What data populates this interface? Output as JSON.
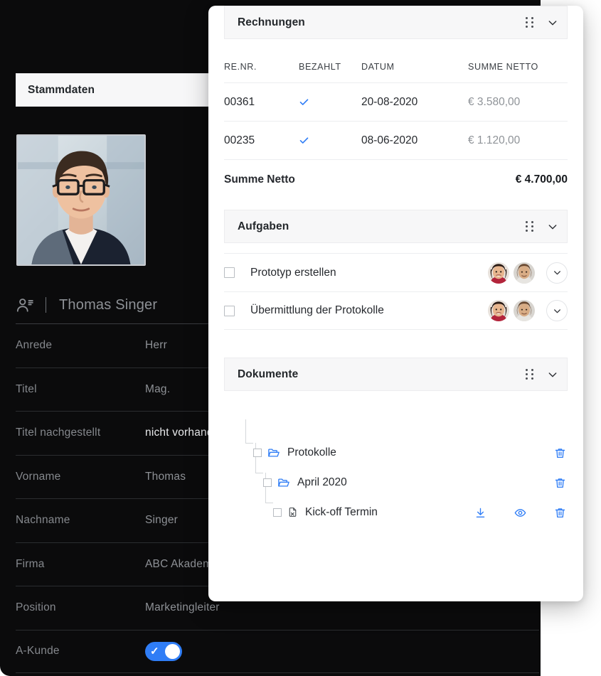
{
  "master_data": {
    "header_title": "Stammdaten",
    "person": {
      "icon": "contact-person-icon",
      "name": "Thomas Singer",
      "photo_alt": "portrait-photo"
    },
    "fields": [
      {
        "label": "Anrede",
        "value": "Herr"
      },
      {
        "label": "Titel",
        "value": "Mag."
      },
      {
        "label": "Titel nachgestellt",
        "value": "nicht vorhanden"
      },
      {
        "label": "Vorname",
        "value": "Thomas"
      },
      {
        "label": "Nachname",
        "value": "Singer"
      },
      {
        "label": "Firma",
        "value": "ABC Akademie"
      },
      {
        "label": "Position",
        "value": "Marketingleiter"
      },
      {
        "label": "A-Kunde",
        "value": ""
      }
    ],
    "toggle": {
      "label": "A-Kunde",
      "state": "on",
      "color": "#2f7df6"
    }
  },
  "card": {
    "invoices": {
      "title": "Rechnungen",
      "columns": [
        "RE.NR.",
        "BEZAHLT",
        "DATUM",
        "SUMME NETTO"
      ],
      "rows": [
        {
          "nr": "00361",
          "paid": true,
          "date": "20-08-2020",
          "sum": "€ 3.580,00"
        },
        {
          "nr": "00235",
          "paid": true,
          "date": "08-06-2020",
          "sum": "€ 1.120,00"
        }
      ],
      "total_label": "Summe Netto",
      "total_value": "€ 4.700,00"
    },
    "tasks": {
      "title": "Aufgaben",
      "rows": [
        {
          "label": "Prototyp erstellen",
          "checked": false,
          "assignees": 2
        },
        {
          "label": "Übermittlung der Protokolle",
          "checked": false,
          "assignees": 2
        }
      ]
    },
    "documents": {
      "title": "Dokumente",
      "rows": [
        {
          "label": "Protokolle",
          "type": "folder",
          "level": 0,
          "actions": [
            "delete"
          ]
        },
        {
          "label": "April 2020",
          "type": "folder",
          "level": 1,
          "actions": [
            "delete"
          ]
        },
        {
          "label": "Kick-off Termin",
          "type": "file",
          "level": 2,
          "actions": [
            "download",
            "preview",
            "delete"
          ]
        }
      ]
    },
    "accent_color": "#2f7df6"
  }
}
